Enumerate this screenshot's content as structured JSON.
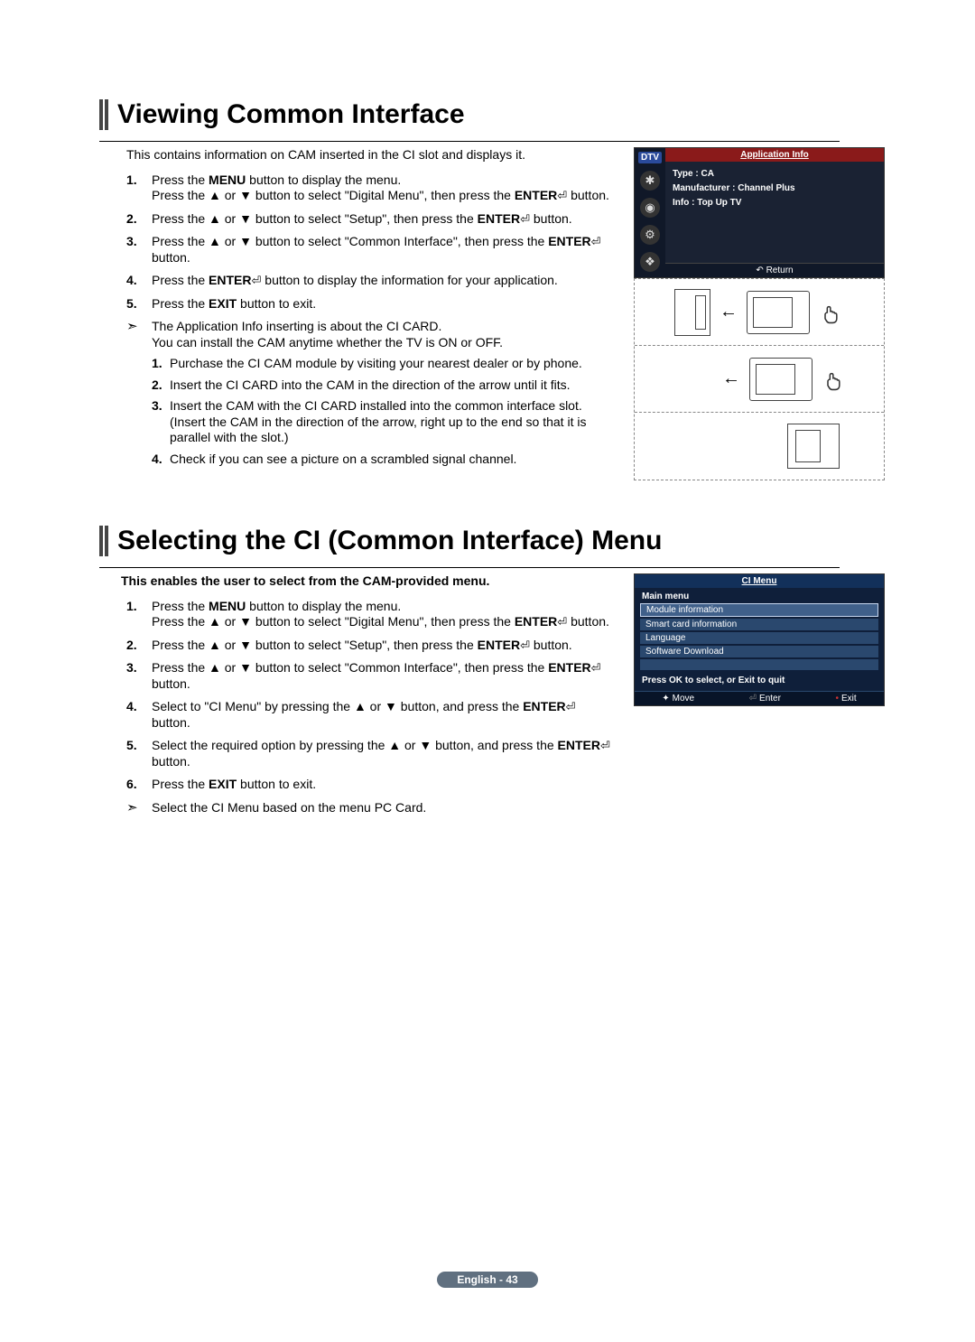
{
  "section1": {
    "heading": "Viewing Common Interface",
    "intro": "This contains information on CAM inserted in the CI slot and displays it.",
    "steps": {
      "s1a": "Press the ",
      "s1_menu": "MENU",
      "s1b": " button to display the menu.",
      "s1c": "Press the ▲ or ▼ button to select \"Digital Menu\", then press the ",
      "s1_enter": "ENTER",
      "s1d": " button.",
      "s2a": "Press the ▲ or ▼ button to select \"Setup\", then press the ",
      "s2_enter": "ENTER",
      "s2b": " button.",
      "s3a": "Press the ▲ or ▼ button to select \"Common Interface\", then press the ",
      "s3_enter": "ENTER",
      "s3b": " button.",
      "s4a": "Press the ",
      "s4_enter": "ENTER",
      "s4b": " button to display the information for your application.",
      "s5a": "Press the ",
      "s5_exit": "EXIT",
      "s5b": " button to exit."
    },
    "note1a": "The Application Info inserting is about the CI CARD.",
    "note1b": "You can install the CAM anytime whether the TV is ON or OFF.",
    "sub": {
      "i1": "Purchase the CI CAM module by visiting your nearest dealer or by phone.",
      "i2": "Insert the CI CARD into the CAM in the direction of the arrow until it fits.",
      "i3": "Insert the CAM with the CI CARD installed into the common interface slot.",
      "i3b": "(Insert the CAM in the direction of the arrow, right up to the end so that it is parallel with the slot.)",
      "i4": "Check if you can see a picture on a scrambled signal channel."
    },
    "dtv": {
      "badge": "DTV",
      "title": "Application Info",
      "type": "Type : CA",
      "manu": "Manufacturer : Channel Plus",
      "info": "Info : Top Up TV",
      "return": "Return"
    }
  },
  "section2": {
    "heading": "Selecting the CI (Common Interface) Menu",
    "intro": "This enables the user to select from the CAM-provided menu.",
    "steps": {
      "s1a": "Press the ",
      "s1_menu": "MENU",
      "s1b": " button to display the menu.",
      "s1c": "Press the ▲ or ▼ button to select \"Digital Menu\", then press the ",
      "s1_enter": "ENTER",
      "s1d": " button.",
      "s2a": "Press the ▲ or ▼ button to select \"Setup\", then press the ",
      "s2_enter": "ENTER",
      "s2b": " button.",
      "s3a": "Press the ▲ or ▼ button to select \"Common Interface\", then press the ",
      "s3_enter": "ENTER",
      "s3b": " button.",
      "s4a": "Select to \"CI Menu\" by pressing the ▲ or ▼ button, and press the ",
      "s4_enter": "ENTER",
      "s4b": " button.",
      "s5a": "Select the required option by pressing the ▲ or ▼ button, and press the ",
      "s5_enter": "ENTER",
      "s5b": " button.",
      "s6a": "Press the ",
      "s6_exit": "EXIT",
      "s6b": " button to exit."
    },
    "note": "Select the CI Menu based on the menu PC Card.",
    "ci": {
      "title": "CI Menu",
      "main": "Main menu",
      "items": [
        "Module information",
        "Smart card information",
        "Language",
        "Software Download"
      ],
      "hint": "Press OK to select, or Exit to quit",
      "move": "Move",
      "enter": "Enter",
      "exit": "Exit"
    }
  },
  "footer": "English - 43"
}
